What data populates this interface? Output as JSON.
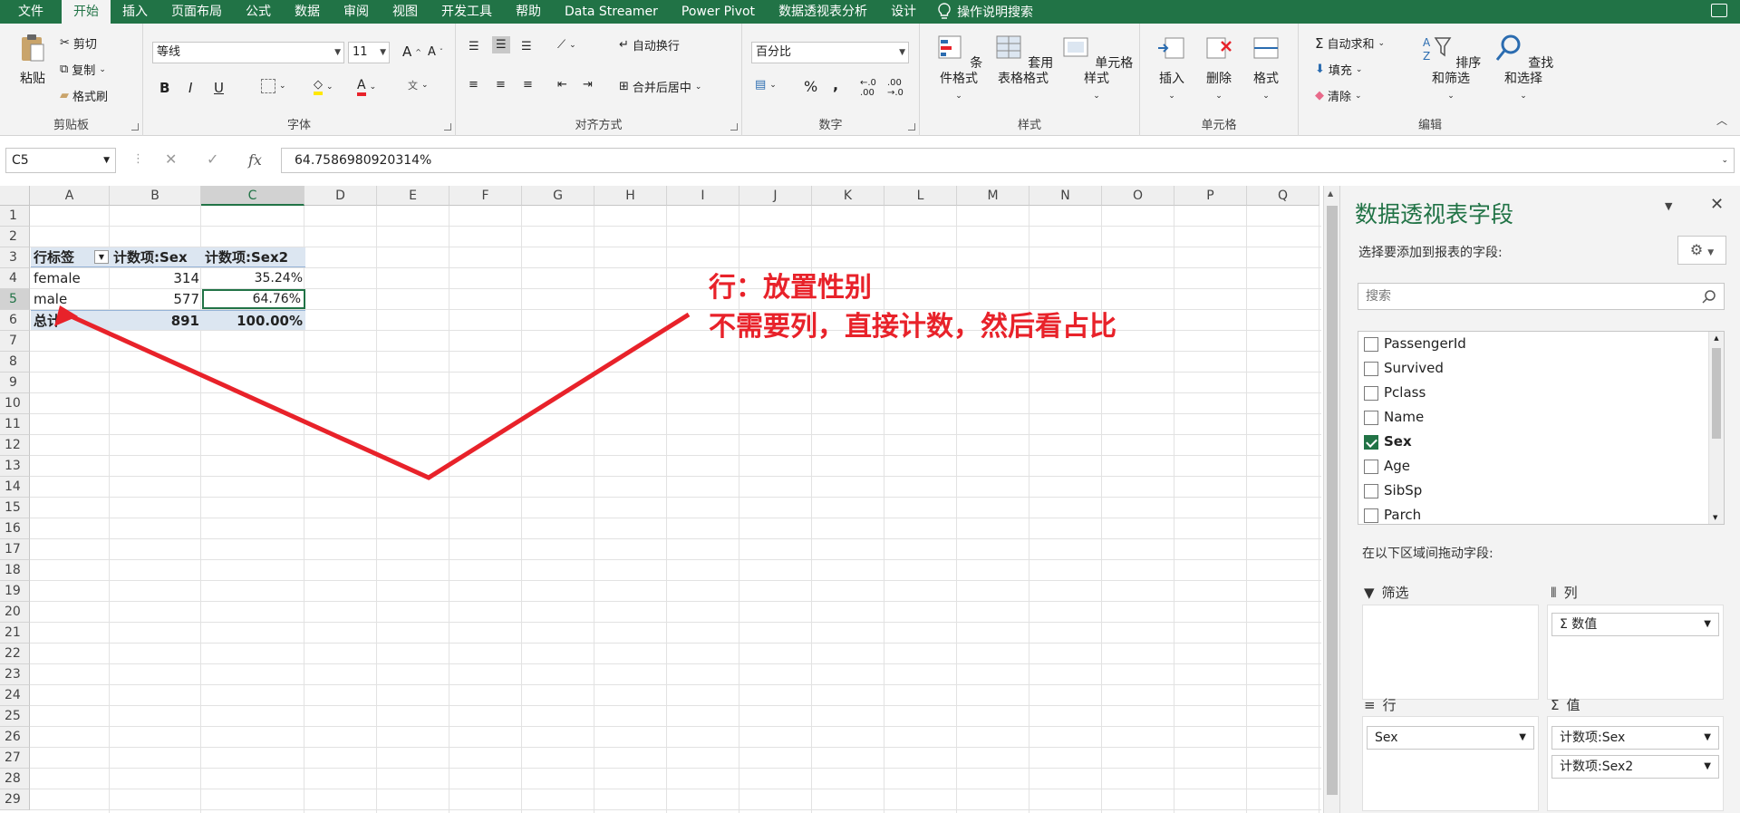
{
  "menu": {
    "tabs": [
      "文件",
      "开始",
      "插入",
      "页面布局",
      "公式",
      "数据",
      "审阅",
      "视图",
      "开发工具",
      "帮助",
      "Data Streamer",
      "Power Pivot",
      "数据透视表分析",
      "设计"
    ],
    "active_tab": "开始",
    "tell_me": "操作说明搜索"
  },
  "ribbon": {
    "clipboard": {
      "paste": "粘贴",
      "cut": "剪切",
      "copy": "复制",
      "format_painter": "格式刷",
      "label": "剪贴板"
    },
    "font": {
      "name": "等线",
      "size": "11",
      "bold": "B",
      "italic": "I",
      "underline": "U",
      "label": "字体",
      "font_color": "A",
      "grow": "A",
      "shrink": "A"
    },
    "align": {
      "wrap": "自动换行",
      "merge": "合并后居中",
      "label": "对齐方式"
    },
    "number": {
      "format": "百分比",
      "percent": "%",
      "comma": ",",
      "label": "数字"
    },
    "styles": {
      "conditional": "条件格式",
      "table_l1": "套用",
      "table_l2": "表格格式",
      "cell_styles": "单元格样式",
      "label": "样式"
    },
    "cells": {
      "insert": "插入",
      "delete": "删除",
      "format": "格式",
      "label": "单元格"
    },
    "editing": {
      "autosum": "自动求和",
      "fill": "填充",
      "clear": "清除",
      "sort": "排序和筛选",
      "find": "查找和选择",
      "label": "编辑"
    }
  },
  "formula_bar": {
    "name_box": "C5",
    "fx": "fx",
    "value": "64.7586980920314%"
  },
  "columns": [
    "A",
    "B",
    "C",
    "D",
    "E",
    "F",
    "G",
    "H",
    "I",
    "J",
    "K",
    "L",
    "M",
    "N",
    "O",
    "P",
    "Q"
  ],
  "selected_column": "C",
  "rows": [
    "1",
    "2",
    "3",
    "4",
    "5",
    "6",
    "7",
    "8",
    "9",
    "10",
    "11",
    "12",
    "13",
    "14",
    "15",
    "16",
    "17",
    "18",
    "19",
    "20",
    "21",
    "22",
    "23",
    "24",
    "25",
    "26",
    "27",
    "28",
    "29"
  ],
  "selected_row": "5",
  "pivot": {
    "header": [
      "行标签",
      "计数项:Sex",
      "计数项:Sex2"
    ],
    "rows": [
      {
        "label": "female",
        "count": "314",
        "pct": "35.24%"
      },
      {
        "label": "male",
        "count": "577",
        "pct": "64.76%"
      }
    ],
    "total": {
      "label": "总计",
      "count": "891",
      "pct": "100.00%"
    }
  },
  "annotation": {
    "line1": "行：放置性别",
    "line2": "不需要列，直接计数，然后看占比",
    "color": "#e8222a"
  },
  "panel": {
    "title": "数据透视表字段",
    "subtitle": "选择要添加到报表的字段:",
    "search_placeholder": "搜索",
    "fields": [
      {
        "name": "PassengerId",
        "checked": false
      },
      {
        "name": "Survived",
        "checked": false
      },
      {
        "name": "Pclass",
        "checked": false
      },
      {
        "name": "Name",
        "checked": false
      },
      {
        "name": "Sex",
        "checked": true
      },
      {
        "name": "Age",
        "checked": false
      },
      {
        "name": "SibSp",
        "checked": false
      },
      {
        "name": "Parch",
        "checked": false
      }
    ],
    "drag_hint": "在以下区域间拖动字段:",
    "filters_label": "筛选",
    "columns_label": "列",
    "columns_items": [
      "数值"
    ],
    "rows_label": "行",
    "rows_items": [
      "Sex"
    ],
    "values_label": "值",
    "values_items": [
      "计数项:Sex",
      "计数项:Sex2"
    ]
  },
  "accent_color": "#217346"
}
